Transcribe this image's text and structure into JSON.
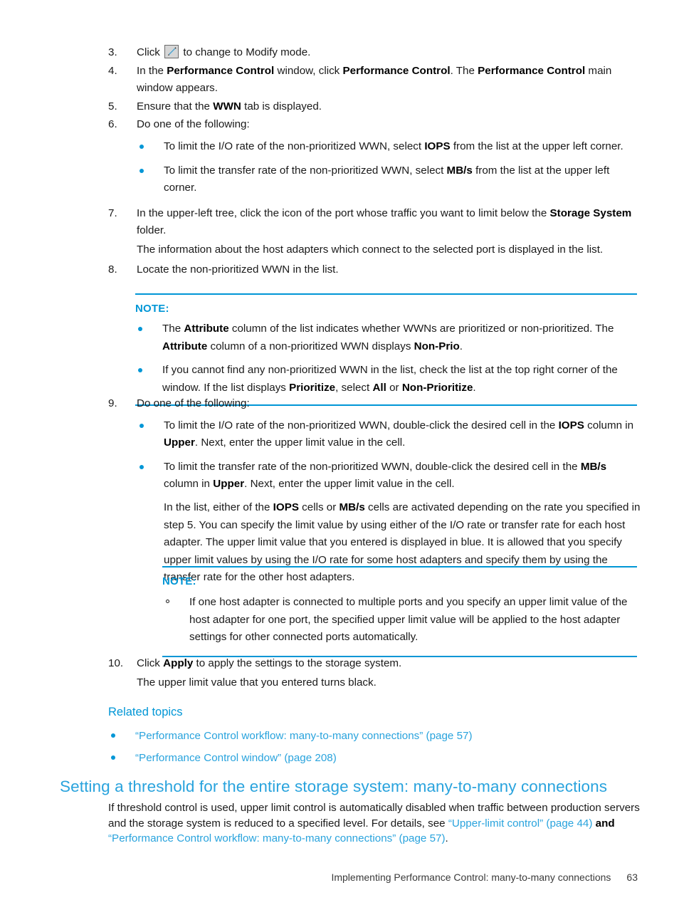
{
  "document": {
    "page_number": "63",
    "footer_title": "Implementing Performance Control: many-to-many connections",
    "accent_blue": "#0096D6",
    "link_blue": "#29A3DD"
  },
  "steps": [
    {
      "number": "3.",
      "text_before_icon": "Click",
      "icon": "pencil-modify-mode-icon",
      "text_after_icon": "to change to Modify mode."
    },
    {
      "number": "4.",
      "line1_a": "In the ",
      "line1_b1": "Performance Control",
      "line1_c": " window, click ",
      "line1_b2": "Performance Control",
      "line1_d": ". The ",
      "line1_b3": "Performance Control",
      "line1_e": " main window appears."
    },
    {
      "number": "5.",
      "a": "Ensure that the ",
      "b": "WWN",
      "c": " tab is displayed."
    },
    {
      "number": "6.",
      "text": "Do one of the following:",
      "bullets": [
        {
          "a": "To limit the I/O rate of the non-prioritized WWN, select ",
          "b": "IOPS",
          "c": " from the list at the upper left corner."
        },
        {
          "a": "To limit the transfer rate of the non-prioritized WWN, select ",
          "b": "MB/s",
          "c": " from the list at the upper left corner."
        }
      ]
    },
    {
      "number": "7.",
      "a": "In the upper-left tree, click the icon of the port whose traffic you want to limit below the ",
      "b": "Storage System",
      "c": " folder.",
      "extra": "The information about the host adapters which connect to the selected port is displayed in the list."
    },
    {
      "number": "8.",
      "text": "Locate the non-prioritized WWN in the list."
    }
  ],
  "note_1": {
    "title": "NOTE:",
    "bullets": [
      {
        "a": "The ",
        "b1": "Attribute",
        "c": " column of the list indicates whether WWNs are prioritized or non-prioritized. The ",
        "b2": "Attribute",
        "d": " column of a non-prioritized WWN displays ",
        "b3": "Non-Prio",
        "e": "."
      },
      {
        "a": "If you cannot find any non-prioritized WWN in the list, check the list at the top right corner of the window. If the list displays ",
        "b1": "Prioritize",
        "c": ", select ",
        "b2": "All",
        "d": " or ",
        "b3": "Non-Prioritize",
        "e": "."
      }
    ]
  },
  "step_9": {
    "number": "9.",
    "text": "Do one of the following:",
    "bullets": [
      {
        "a": "To limit the I/O rate of the non-prioritized WWN, double-click the desired cell in the ",
        "b1": "IOPS",
        "c": " column in ",
        "b2": "Upper",
        "d": ". Next, enter the upper limit value in the cell."
      },
      {
        "a": "To limit the transfer rate of the non-prioritized WWN, double-click the desired cell in the ",
        "b1": "MB/s",
        "c": " column in ",
        "b2": "Upper",
        "d": ". Next, enter the upper limit value in the cell."
      }
    ],
    "paragraph": {
      "a": "In the list, either of the ",
      "b1": "IOPS",
      "c": " cells or ",
      "b2": "MB/s",
      "d": " cells are activated depending on the rate you specified in step 5. You can specify the limit value by using either of the I/O rate or transfer rate for each host adapter. The upper limit value that you entered is displayed in blue. It is allowed that you specify upper limit values by using the I/O rate for some host adapters and specify them by using the transfer rate for the other host adapters."
    }
  },
  "note_2": {
    "title": "NOTE:",
    "bullet": "If one host adapter is connected to multiple ports and you specify an upper limit value of the host adapter for one port, the specified upper limit value will be applied to the host adapter settings for other connected ports automatically."
  },
  "step_10": {
    "number": "10.",
    "a": "Click ",
    "b": "Apply",
    "c": " to apply the settings to the storage system.",
    "extra": "The upper limit value that you entered turns black."
  },
  "related": {
    "heading": "Related topics",
    "links": [
      "“Performance Control workflow: many-to-many connections” (page 57)",
      "“Performance Control window” (page 208)"
    ]
  },
  "section": {
    "heading": "Setting a threshold for the entire storage system: many-to-many connections",
    "body_a": "If threshold control is used, upper limit control is automatically disabled when traffic between production servers and the storage system is reduced to a specified level. For details, see ",
    "body_link1": "“Upper-limit control” (page 44)",
    "body_and": " and ",
    "body_link2": "“Performance Control workflow: many-to-many connections” (page 57)",
    "body_end": "."
  }
}
